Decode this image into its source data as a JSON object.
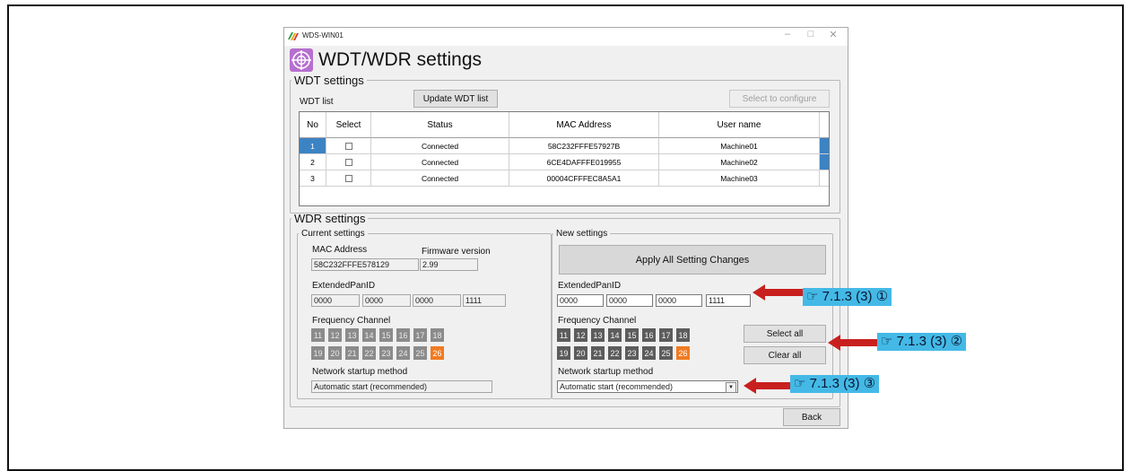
{
  "window": {
    "title": "WDS-WIN01",
    "heading": "WDT/WDR settings"
  },
  "wdt": {
    "legend": "WDT settings",
    "list_label": "WDT list",
    "update_button": "Update WDT list",
    "select_configure_button": "Select to configure",
    "columns": [
      "No",
      "Select",
      "Status",
      "MAC Address",
      "User name"
    ],
    "rows": [
      {
        "no": "1",
        "status": "Connected",
        "mac": "58C232FFFE57927B",
        "user": "Machine01",
        "selected_row": true,
        "indicator": true
      },
      {
        "no": "2",
        "status": "Connected",
        "mac": "6CE4DAFFFE019955",
        "user": "Machine02",
        "selected_row": false,
        "indicator": true
      },
      {
        "no": "3",
        "status": "Connected",
        "mac": "00004CFFFEC8A5A1",
        "user": "Machine03",
        "selected_row": false,
        "indicator": false
      }
    ]
  },
  "wdr": {
    "legend": "WDR settings",
    "current": {
      "legend": "Current settings",
      "mac_label": "MAC Address",
      "mac_value": "58C232FFFE578129",
      "fw_label": "Firmware version",
      "fw_value": "2.99",
      "pan_label": "ExtendedPanID",
      "pan": [
        "0000",
        "0000",
        "0000",
        "1111"
      ],
      "freq_label": "Frequency Channel",
      "startup_label": "Network startup method",
      "startup_value": "Automatic start (recommended)"
    },
    "new": {
      "legend": "New settings",
      "apply_button": "Apply All Setting Changes",
      "pan_label": "ExtendedPanID",
      "pan": [
        "0000",
        "0000",
        "0000",
        "1111"
      ],
      "freq_label": "Frequency Channel",
      "select_all": "Select all",
      "clear_all": "Clear all",
      "startup_label": "Network startup method",
      "startup_value": "Automatic start (recommended)"
    },
    "channels": [
      "11",
      "12",
      "13",
      "14",
      "15",
      "16",
      "17",
      "18",
      "19",
      "20",
      "21",
      "22",
      "23",
      "24",
      "25",
      "26"
    ],
    "selected_channel": "26"
  },
  "back_button": "Back",
  "refs": [
    "☞ 7.1.3 (3) ①",
    "☞ 7.1.3 (3) ②",
    "☞ 7.1.3 (3) ③"
  ],
  "colors": {
    "accent": "#3c83c4",
    "channel_selected": "#f07b22",
    "arrow": "#c8201e",
    "ref_box": "#44b9e6"
  }
}
